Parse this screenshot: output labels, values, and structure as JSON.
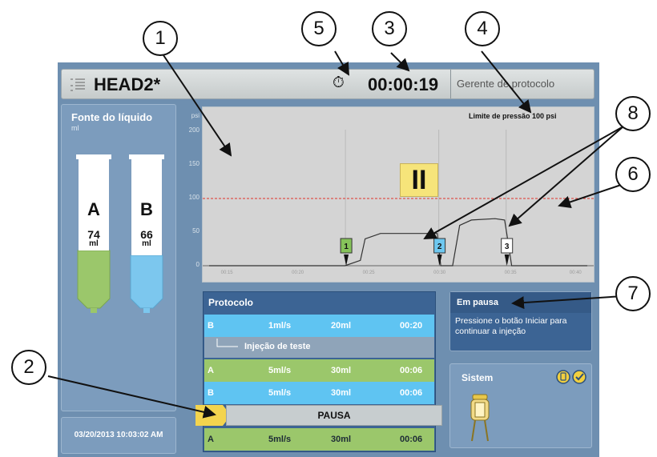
{
  "header": {
    "protocol_name": "HEAD2*",
    "timer": "00:00:19",
    "manager_label": "Gerente de protocolo"
  },
  "fluid_source": {
    "title": "Fonte do líquido",
    "unit": "ml",
    "syringes": [
      {
        "label": "A",
        "volume": "74",
        "unit": "ml",
        "color": "#9bc76b",
        "fill_fraction": 0.4
      },
      {
        "label": "B",
        "volume": "66",
        "unit": "ml",
        "color": "#7cc7ee",
        "fill_fraction": 0.35
      }
    ]
  },
  "datetime": "03/20/2013 10:03:02 AM",
  "chart": {
    "y_unit": "psi",
    "pressure_limit_label": "Limite de pressão 100 psi",
    "pause_symbol": "II",
    "phase_markers": [
      "1",
      "2",
      "3"
    ],
    "limit_color": "#e0332b"
  },
  "chart_data": {
    "type": "line",
    "x": [
      "00:15",
      "00:20",
      "00:25",
      "00:30",
      "00:35",
      "00:40"
    ],
    "y_ticks": [
      0,
      50,
      100,
      150,
      200
    ],
    "ylim": [
      0,
      200
    ],
    "ylabel": "psi",
    "pressure_limit": 100,
    "series": [
      {
        "points": [
          [
            0,
            0
          ],
          [
            11.5,
            0
          ],
          [
            12.8,
            8
          ],
          [
            13.2,
            40
          ],
          [
            14.5,
            48
          ],
          [
            17.5,
            48
          ],
          [
            19.3,
            48
          ],
          [
            19.6,
            0
          ],
          [
            20.6,
            0
          ],
          [
            21.2,
            60
          ],
          [
            22.2,
            68
          ],
          [
            24.2,
            70
          ],
          [
            25.0,
            68
          ],
          [
            25.3,
            35
          ],
          [
            25.6,
            0
          ],
          [
            32,
            0
          ]
        ]
      }
    ],
    "markers": [
      {
        "label": "1",
        "x": 11.6,
        "color": "#86c35a"
      },
      {
        "label": "2",
        "x": 19.5,
        "color": "#6ec8f0"
      },
      {
        "label": "3",
        "x": 25.2,
        "color": "#ffffff"
      }
    ]
  },
  "protocol": {
    "title": "Protocolo",
    "rows": [
      {
        "syringe": "B",
        "rate": "1ml/s",
        "volume": "20ml",
        "time": "00:20"
      },
      {
        "syringe": "A",
        "rate": "5ml/s",
        "volume": "30ml",
        "time": "00:06"
      },
      {
        "syringe": "B",
        "rate": "5ml/s",
        "volume": "30ml",
        "time": "00:06"
      },
      {
        "syringe": "A",
        "rate": "5ml/s",
        "volume": "30ml",
        "time": "00:06"
      }
    ],
    "test_injection_label": "Injeção de teste",
    "pause_label": "PAUSA"
  },
  "status": {
    "title": "Em pausa",
    "message": "Pressione o botão Iniciar para continuar a injeção"
  },
  "system": {
    "title": "Sistem"
  },
  "callouts": [
    "1",
    "2",
    "3",
    "4",
    "5",
    "6",
    "7",
    "8"
  ]
}
